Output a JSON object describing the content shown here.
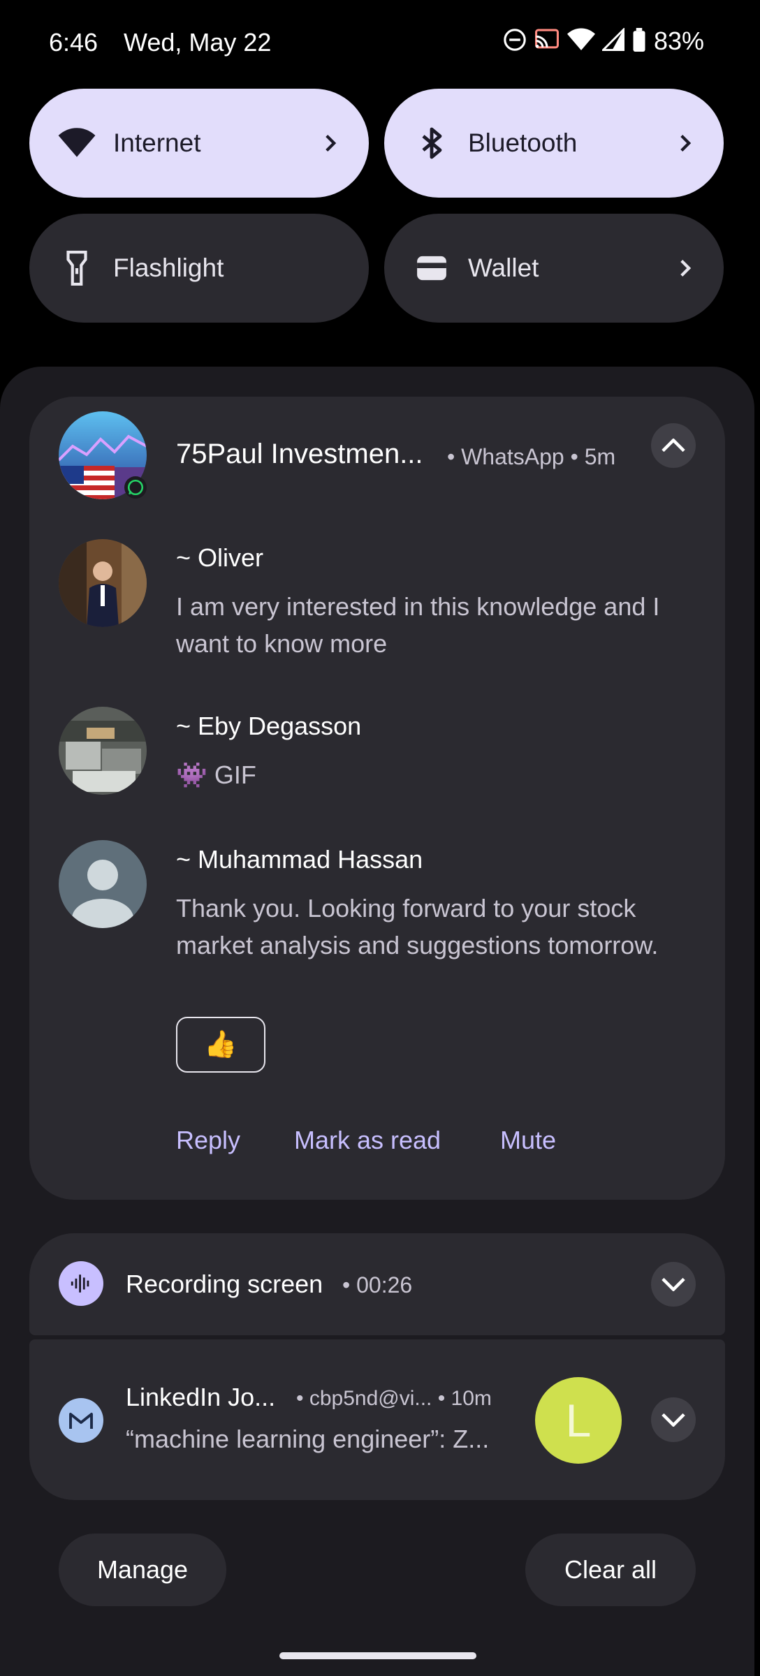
{
  "status_bar": {
    "time": "6:46",
    "date": "Wed, May 22",
    "battery": "83%",
    "icons": [
      "do-not-disturb-icon",
      "cast-icon",
      "wifi-icon",
      "signal-icon",
      "battery-icon"
    ]
  },
  "tiles": {
    "internet": "Internet",
    "bluetooth": "Bluetooth",
    "flashlight": "Flashlight",
    "wallet": "Wallet"
  },
  "whatsapp": {
    "title": "75Paul Investmen...",
    "meta": "• WhatsApp • 5m",
    "messages": [
      {
        "sender": "~ Oliver",
        "line1": "I am very interested in this knowledge and I",
        "line2": "want to know more"
      },
      {
        "sender": "~ Eby Degasson",
        "line1": "👾 GIF"
      },
      {
        "sender": "~ Muhammad Hassan",
        "line1": "Thank you. Looking forward to your stock",
        "line2": "market analysis and suggestions tomorrow."
      }
    ],
    "reaction": "👍",
    "actions": {
      "reply": "Reply",
      "mark_read": "Mark as read",
      "mute": "Mute"
    }
  },
  "recording": {
    "title": "Recording screen",
    "time": "• 00:26"
  },
  "linkedin": {
    "title": "LinkedIn Jo...",
    "meta": "• cbp5nd@vi... • 10m",
    "body": "“machine learning engineer”: Z...",
    "avatar_letter": "L"
  },
  "footer": {
    "manage": "Manage",
    "clear_all": "Clear all"
  },
  "colors": {
    "accent": "#c8bfff",
    "tile_active": "#e2ddfb",
    "card_bg": "#2b2a30",
    "linkedin_avatar": "#cfe04e"
  }
}
